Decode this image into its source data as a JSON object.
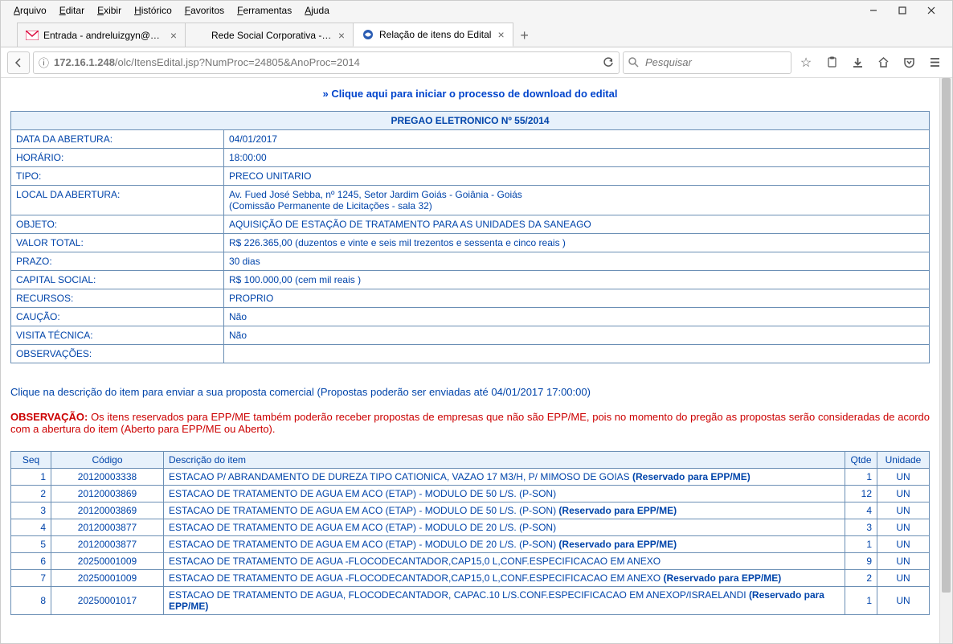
{
  "menu": {
    "items": [
      "Arquivo",
      "Editar",
      "Exibir",
      "Histórico",
      "Favoritos",
      "Ferramentas",
      "Ajuda"
    ]
  },
  "tabs": [
    {
      "title": "Entrada - andreluizgyn@g…",
      "icon": "gmail"
    },
    {
      "title": "Rede Social Corporativa - Sane…",
      "icon": "generic"
    },
    {
      "title": "Relação de itens do Edital",
      "icon": "blue-swirl",
      "active": true
    }
  ],
  "url": {
    "host": "172.16.1.248",
    "path": "/olc/ItensEdital.jsp?NumProc=24805&AnoProc=2014"
  },
  "search": {
    "placeholder": "Pesquisar"
  },
  "download_link": "» Clique aqui para iniciar o processo de download do edital",
  "proc_header": "PREGAO ELETRONICO Nº 55/2014",
  "info_rows": [
    {
      "label": "DATA DA ABERTURA:",
      "value": "04/01/2017"
    },
    {
      "label": "HORÁRIO:",
      "value": "18:00:00"
    },
    {
      "label": "TIPO:",
      "value": "PRECO UNITARIO"
    },
    {
      "label": "LOCAL DA ABERTURA:",
      "value": "Av. Fued José Sebba, nº 1245, Setor Jardim Goiás - Goiânia - Goiás\n(Comissão Permanente de Licitações - sala 32)"
    },
    {
      "label": "OBJETO:",
      "value": "AQUISIÇÃO DE ESTAÇÃO DE TRATAMENTO PARA AS UNIDADES DA SANEAGO"
    },
    {
      "label": "VALOR TOTAL:",
      "value": "R$ 226.365,00 (duzentos e vinte e seis mil trezentos e sessenta e cinco reais )"
    },
    {
      "label": "PRAZO:",
      "value": "30 dias"
    },
    {
      "label": "CAPITAL SOCIAL:",
      "value": "R$ 100.000,00 (cem mil reais )"
    },
    {
      "label": "RECURSOS:",
      "value": "PROPRIO"
    },
    {
      "label": "CAUÇÃO:",
      "value": "Não"
    },
    {
      "label": "VISITA TÉCNICA:",
      "value": "Não"
    },
    {
      "label": "OBSERVAÇÕES:",
      "value": ""
    }
  ],
  "proposal_note": "Clique na descrição do item para enviar a sua proposta comercial (Propostas poderão ser enviadas até 04/01/2017 17:00:00)",
  "obs_label": "OBSERVAÇÃO:",
  "obs_text": "Os itens reservados para EPP/ME também poderão receber propostas de empresas que não são EPP/ME, pois no momento do pregão as propostas serão consideradas de acordo com a abertura do item (Aberto para EPP/ME ou Aberto).",
  "item_headers": {
    "seq": "Seq",
    "code": "Código",
    "desc": "Descrição do item",
    "qty": "Qtde",
    "unit": "Unidade"
  },
  "reserved_suffix": "(Reservado para EPP/ME)",
  "items": [
    {
      "seq": 1,
      "code": "20120003338",
      "desc": "ESTACAO P/ ABRANDAMENTO DE DUREZA TIPO CATIONICA, VAZAO 17 M3/H, P/ MIMOSO DE GOIAS",
      "reserved": true,
      "qty": 1,
      "unit": "UN"
    },
    {
      "seq": 2,
      "code": "20120003869",
      "desc": "ESTACAO DE TRATAMENTO DE AGUA EM ACO (ETAP) - MODULO DE 50 L/S. (P-SON)",
      "reserved": false,
      "qty": 12,
      "unit": "UN"
    },
    {
      "seq": 3,
      "code": "20120003869",
      "desc": "ESTACAO DE TRATAMENTO DE AGUA EM ACO (ETAP) - MODULO DE 50 L/S. (P-SON)",
      "reserved": true,
      "qty": 4,
      "unit": "UN"
    },
    {
      "seq": 4,
      "code": "20120003877",
      "desc": "ESTACAO DE TRATAMENTO DE AGUA EM ACO (ETAP) - MODULO DE 20 L/S. (P-SON)",
      "reserved": false,
      "qty": 3,
      "unit": "UN"
    },
    {
      "seq": 5,
      "code": "20120003877",
      "desc": "ESTACAO DE TRATAMENTO DE AGUA EM ACO (ETAP) - MODULO DE 20 L/S. (P-SON)",
      "reserved": true,
      "qty": 1,
      "unit": "UN"
    },
    {
      "seq": 6,
      "code": "20250001009",
      "desc": "ESTACAO DE TRATAMENTO DE AGUA -FLOCODECANTADOR,CAP15,0 L,CONF.ESPECIFICACAO EM ANEXO",
      "reserved": false,
      "qty": 9,
      "unit": "UN"
    },
    {
      "seq": 7,
      "code": "20250001009",
      "desc": "ESTACAO DE TRATAMENTO DE AGUA -FLOCODECANTADOR,CAP15,0 L,CONF.ESPECIFICACAO EM ANEXO",
      "reserved": true,
      "qty": 2,
      "unit": "UN"
    },
    {
      "seq": 8,
      "code": "20250001017",
      "desc": "ESTACAO DE TRATAMENTO DE AGUA, FLOCODECANTADOR, CAPAC.10 L/S.CONF.ESPECIFICACAO EM ANEXOP/ISRAELANDI",
      "reserved": true,
      "qty": 1,
      "unit": "UN"
    }
  ]
}
